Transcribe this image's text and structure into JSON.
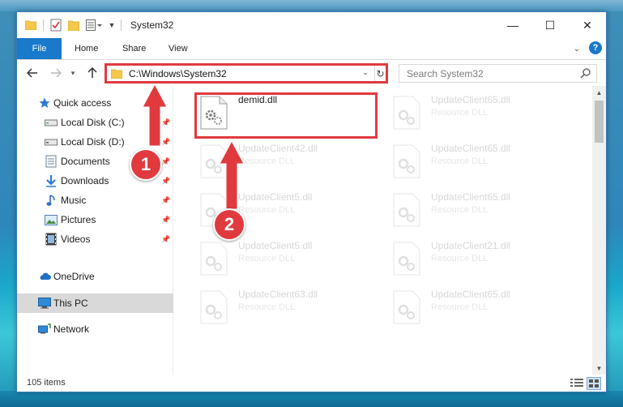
{
  "window": {
    "title": "System32",
    "controls": {
      "minimize": "—",
      "maximize": "☐",
      "close": "✕"
    }
  },
  "ribbon": {
    "tabs": [
      "File",
      "Home",
      "Share",
      "View"
    ],
    "help": "?"
  },
  "navigation": {
    "address": "C:\\Windows\\System32",
    "search_placeholder": "Search System32"
  },
  "sidebar": {
    "items": [
      {
        "label": "Quick access",
        "icon": "star-icon",
        "pinned": false
      },
      {
        "label": "Local Disk (C:)",
        "icon": "drive-icon",
        "pinned": true
      },
      {
        "label": "Local Disk (D:)",
        "icon": "drive-icon",
        "pinned": true
      },
      {
        "label": "Documents",
        "icon": "documents-icon",
        "pinned": true
      },
      {
        "label": "Downloads",
        "icon": "download-icon",
        "pinned": true
      },
      {
        "label": "Music",
        "icon": "music-icon",
        "pinned": true
      },
      {
        "label": "Pictures",
        "icon": "pictures-icon",
        "pinned": true
      },
      {
        "label": "Videos",
        "icon": "video-icon",
        "pinned": true
      },
      {
        "label": "OneDrive",
        "icon": "cloud-icon",
        "pinned": false
      },
      {
        "label": "This PC",
        "icon": "computer-icon",
        "pinned": false,
        "selected": true
      },
      {
        "label": "Network",
        "icon": "network-icon",
        "pinned": false
      }
    ]
  },
  "files": [
    {
      "name": "demid.dll",
      "type": "",
      "highlighted": true
    },
    {
      "name": "UpdateClient65.dll",
      "type": "Resource DLL"
    },
    {
      "name": "UpdateClient42.dll",
      "type": "Resource DLL"
    },
    {
      "name": "UpdateClient65.dll",
      "type": "Resource DLL"
    },
    {
      "name": "UpdateClient5.dll",
      "type": "Resource DLL"
    },
    {
      "name": "UpdateClient65.dll",
      "type": "Resource DLL"
    },
    {
      "name": "UpdateClient5.dll",
      "type": "Resource DLL"
    },
    {
      "name": "UpdateClient21.dll",
      "type": "Resource DLL"
    },
    {
      "name": "UpdateClient63.dll",
      "type": "Resource DLL"
    },
    {
      "name": "UpdateClient65.dll",
      "type": "Resource DLL"
    }
  ],
  "status": {
    "item_count": "105 items"
  },
  "annotations": {
    "step1": "1",
    "step2": "2",
    "color": "#e03a3f"
  }
}
